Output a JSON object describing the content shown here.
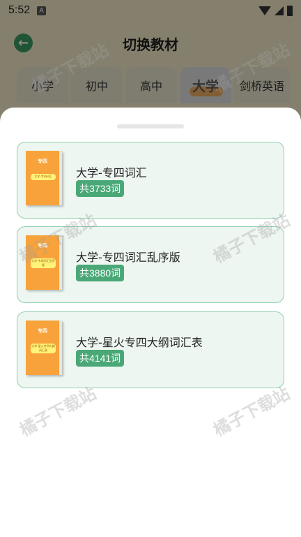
{
  "status_bar": {
    "time": "5:52",
    "notification_letter": "A"
  },
  "header": {
    "title": "切换教材",
    "back_icon": "arrow-left-icon"
  },
  "tabs": [
    {
      "label": "小学"
    },
    {
      "label": "初中"
    },
    {
      "label": "高中"
    },
    {
      "label": "大学",
      "active": true
    },
    {
      "label": "剑桥英语"
    }
  ],
  "books": [
    {
      "cover_title": "专四",
      "cover_label": "大学-专四词汇",
      "name": "大学-专四词汇",
      "count": "共3733词"
    },
    {
      "cover_title": "专四",
      "cover_label": "大学-专四词汇乱序版",
      "name": "大学-专四词汇乱序版",
      "count": "共3880词"
    },
    {
      "cover_title": "专四",
      "cover_label": "大学-星火专四大纲词汇表",
      "name": "大学-星火专四大纲词汇表",
      "count": "共4141词"
    }
  ],
  "watermark": "橘子下载站",
  "colors": {
    "accent": "#4aa877",
    "cover": "#f7a23a",
    "card_bg": "#edf6f1",
    "card_border": "#8fd0ad"
  }
}
